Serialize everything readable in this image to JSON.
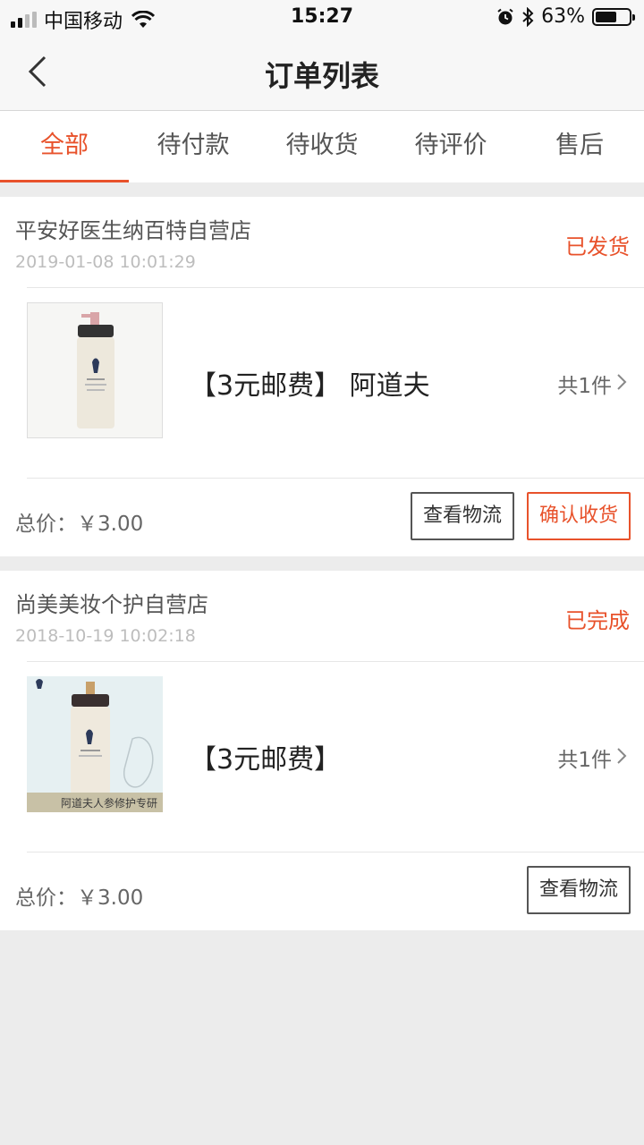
{
  "status_bar": {
    "carrier": "中国移动",
    "time": "15:27",
    "battery_percent": "63%",
    "battery_level": 0.63
  },
  "nav": {
    "title": "订单列表",
    "back_icon": "chevron-left-icon"
  },
  "tabs": [
    {
      "label": "全部",
      "active": true
    },
    {
      "label": "待付款",
      "active": false
    },
    {
      "label": "待收货",
      "active": false
    },
    {
      "label": "待评价",
      "active": false
    },
    {
      "label": "售后",
      "active": false
    }
  ],
  "orders": [
    {
      "shop": "平安好医生纳百特自营店",
      "date": "2019-01-08 10:01:29",
      "status": "已发货",
      "title": "【3元邮费】 阿道夫",
      "qty": "共1件",
      "total": "总价：￥3.00",
      "buttons": {
        "logistics": "查看物流",
        "confirm": "确认收货"
      }
    },
    {
      "shop": "尚美美妆个护自营店",
      "date": "2018-10-19 10:02:18",
      "status": "已完成",
      "title": "【3元邮费】",
      "qty": "共1件",
      "total": "总价：￥3.00",
      "thumb_caption": "阿道夫人参修护专研",
      "buttons": {
        "logistics": "查看物流"
      }
    }
  ],
  "colors": {
    "accent": "#e8522b",
    "background": "#ececec"
  }
}
